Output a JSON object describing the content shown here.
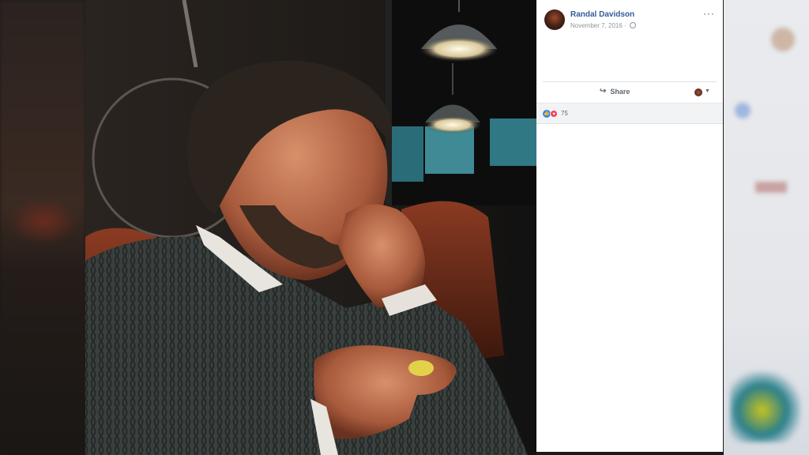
{
  "post": {
    "author": "Randal Davidson",
    "date": "November 7, 2016 ·",
    "privacy_icon": "globe-icon",
    "more_label": "···"
  },
  "actions": {
    "share_label": "Share",
    "share_icon": "share-arrow-icon"
  },
  "reactions": {
    "count": "75",
    "like_glyph": "👍",
    "love_glyph": "♥"
  },
  "colors": {
    "author_link": "#365899",
    "like": "#2d88ff",
    "love": "#f33e58"
  }
}
